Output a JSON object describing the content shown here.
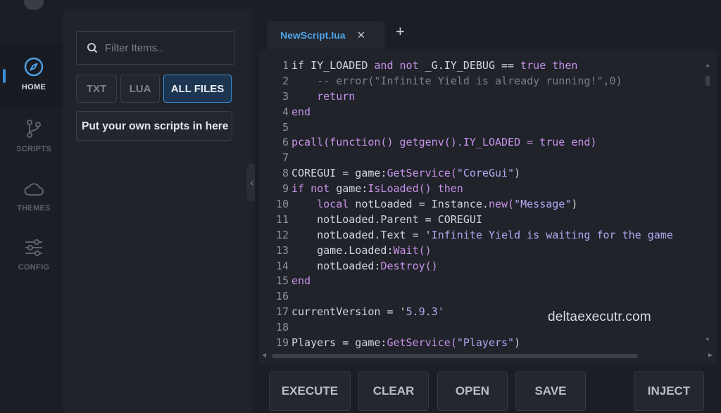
{
  "sidebar": {
    "items": [
      {
        "label": "HOME",
        "icon": "compass-icon",
        "active": true
      },
      {
        "label": "SCRIPTS",
        "icon": "branch-icon",
        "active": false
      },
      {
        "label": "THEMES",
        "icon": "cloud-icon",
        "active": false
      },
      {
        "label": "CONFIG",
        "icon": "sliders-icon",
        "active": false
      }
    ]
  },
  "files": {
    "search_placeholder": "Filter Items..",
    "filters": [
      "TXT",
      "LUA",
      "ALL FILES"
    ],
    "active_filter": "ALL FILES",
    "items": [
      "Put your own scripts in here"
    ]
  },
  "editor": {
    "tab_label": "NewScript.lua",
    "tab_close": "✕",
    "new_tab": "+",
    "lines": [
      {
        "n": "1",
        "t": [
          [
            "if IY_LOADED ",
            "#d3d6dd"
          ],
          [
            "and not ",
            "#c792ea"
          ],
          [
            "_G.IY_DEBUG == ",
            "#d3d6dd"
          ],
          [
            "true then",
            "#c792ea"
          ]
        ]
      },
      {
        "n": "2",
        "t": [
          [
            "    -- error(\"Infinite Yield is already running!\",0)",
            "#7b7f88"
          ]
        ]
      },
      {
        "n": "3",
        "t": [
          [
            "    return",
            "#c792ea"
          ]
        ]
      },
      {
        "n": "4",
        "t": [
          [
            "end",
            "#c792ea"
          ]
        ]
      },
      {
        "n": "5",
        "t": []
      },
      {
        "n": "6",
        "t": [
          [
            "pcall(function() getgenv().IY_LOADED = ",
            "#c792ea"
          ],
          [
            "true end)",
            "#c792ea"
          ]
        ]
      },
      {
        "n": "7",
        "t": []
      },
      {
        "n": "8",
        "t": [
          [
            "COREGUI = game:",
            "#d3d6dd"
          ],
          [
            "GetService(",
            "#c792ea"
          ],
          [
            "\"CoreGui\"",
            "#b4a7f5"
          ],
          [
            ")",
            "#d3d6dd"
          ]
        ]
      },
      {
        "n": "9",
        "t": [
          [
            "if not ",
            "#c792ea"
          ],
          [
            "game:",
            "#d3d6dd"
          ],
          [
            "IsLoaded() ",
            "#c792ea"
          ],
          [
            "then",
            "#c792ea"
          ]
        ]
      },
      {
        "n": "10",
        "t": [
          [
            "    local ",
            "#c792ea"
          ],
          [
            "notLoaded = Instance.",
            "#d3d6dd"
          ],
          [
            "new(",
            "#c792ea"
          ],
          [
            "\"Message\"",
            "#b4a7f5"
          ],
          [
            ")",
            "#d3d6dd"
          ]
        ]
      },
      {
        "n": "11",
        "t": [
          [
            "    notLoaded.Parent = COREGUI",
            "#d3d6dd"
          ]
        ]
      },
      {
        "n": "12",
        "t": [
          [
            "    notLoaded.Text = '",
            "#d3d6dd"
          ],
          [
            "Infinite Yield is waiting for the game",
            "#b4a7f5"
          ]
        ]
      },
      {
        "n": "13",
        "t": [
          [
            "    game.Loaded:",
            "#d3d6dd"
          ],
          [
            "Wait()",
            "#c792ea"
          ]
        ]
      },
      {
        "n": "14",
        "t": [
          [
            "    notLoaded:",
            "#d3d6dd"
          ],
          [
            "Destroy()",
            "#c792ea"
          ]
        ]
      },
      {
        "n": "15",
        "t": [
          [
            "end",
            "#c792ea"
          ]
        ]
      },
      {
        "n": "16",
        "t": []
      },
      {
        "n": "17",
        "t": [
          [
            "currentVersion = '",
            "#d3d6dd"
          ],
          [
            "5.9.3'",
            "#b4a7f5"
          ]
        ]
      },
      {
        "n": "18",
        "t": []
      },
      {
        "n": "19",
        "t": [
          [
            "Players = game:",
            "#d3d6dd"
          ],
          [
            "GetService(",
            "#c792ea"
          ],
          [
            "\"Players\"",
            "#b4a7f5"
          ],
          [
            ")",
            "#d3d6dd"
          ]
        ]
      }
    ]
  },
  "watermark": "deltaexecutr.com",
  "actions": [
    "EXECUTE",
    "CLEAR",
    "OPEN",
    "SAVE",
    "INJECT"
  ],
  "colors": {
    "accent": "#3a8fd9",
    "tab_text": "#4fa3e8",
    "keyword": "#c792ea",
    "string": "#b4a7f5",
    "comment": "#7b7f88"
  }
}
